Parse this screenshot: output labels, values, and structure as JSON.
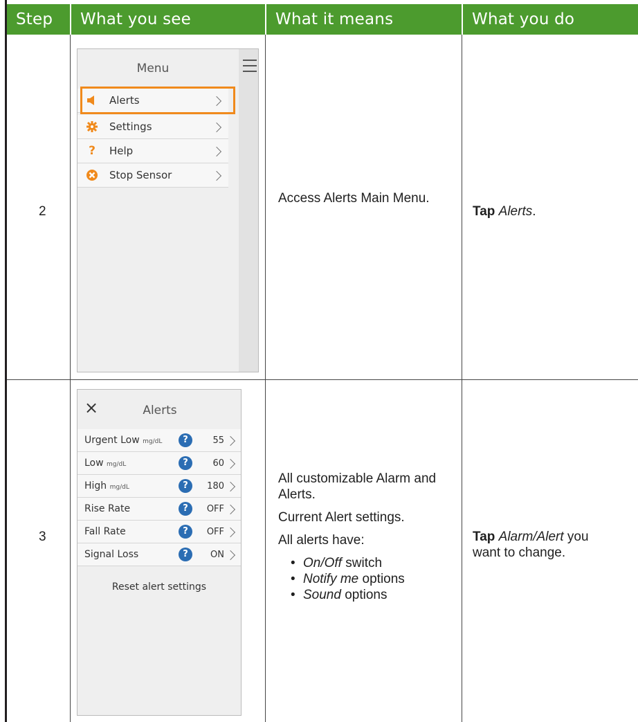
{
  "headers": {
    "step": "Step",
    "what_you_see": "What you see",
    "what_it_means": "What it means",
    "what_you_do": "What you do"
  },
  "rows": [
    {
      "step": "2",
      "means": "Access Alerts Main Menu.",
      "do_bold": "Tap",
      "do_italic": "Alerts",
      "do_suffix": ".",
      "screen": {
        "title": "Menu",
        "items": [
          {
            "label": "Alerts",
            "icon": "speaker-icon"
          },
          {
            "label": "Settings",
            "icon": "gear-icon"
          },
          {
            "label": "Help",
            "icon": "question-icon"
          },
          {
            "label": "Stop Sensor",
            "icon": "stop-icon"
          }
        ],
        "highlight_color": "#f08a1c"
      }
    },
    {
      "step": "3",
      "means_p1": "All customizable Alarm and Alerts.",
      "means_p2": "Current Alert settings.",
      "means_p3": "All alerts have:",
      "bullets": [
        {
          "italic": "On/Off",
          "rest": " switch"
        },
        {
          "italic": "Notify me",
          "rest": " options"
        },
        {
          "italic": "Sound",
          "rest": " options"
        }
      ],
      "do_bold": "Tap",
      "do_italic": "Alarm/Alert",
      "do_suffix": " you want to change.",
      "screen": {
        "title": "Alerts",
        "close_glyph": "×",
        "rows": [
          {
            "label": "Urgent Low",
            "unit": "mg/dL",
            "value": "55"
          },
          {
            "label": "Low",
            "unit": "mg/dL",
            "value": "60"
          },
          {
            "label": "High",
            "unit": "mg/dL",
            "value": "180"
          },
          {
            "label": "Rise Rate",
            "unit": "",
            "value": "OFF"
          },
          {
            "label": "Fall Rate",
            "unit": "",
            "value": "OFF"
          },
          {
            "label": "Signal Loss",
            "unit": "",
            "value": "ON"
          }
        ],
        "help_glyph": "?",
        "reset_label": "Reset alert settings"
      }
    }
  ],
  "colors": {
    "header_green": "#4c9b2e",
    "help_blue": "#2b6db3",
    "alerts_orange": "#f08a1c"
  }
}
